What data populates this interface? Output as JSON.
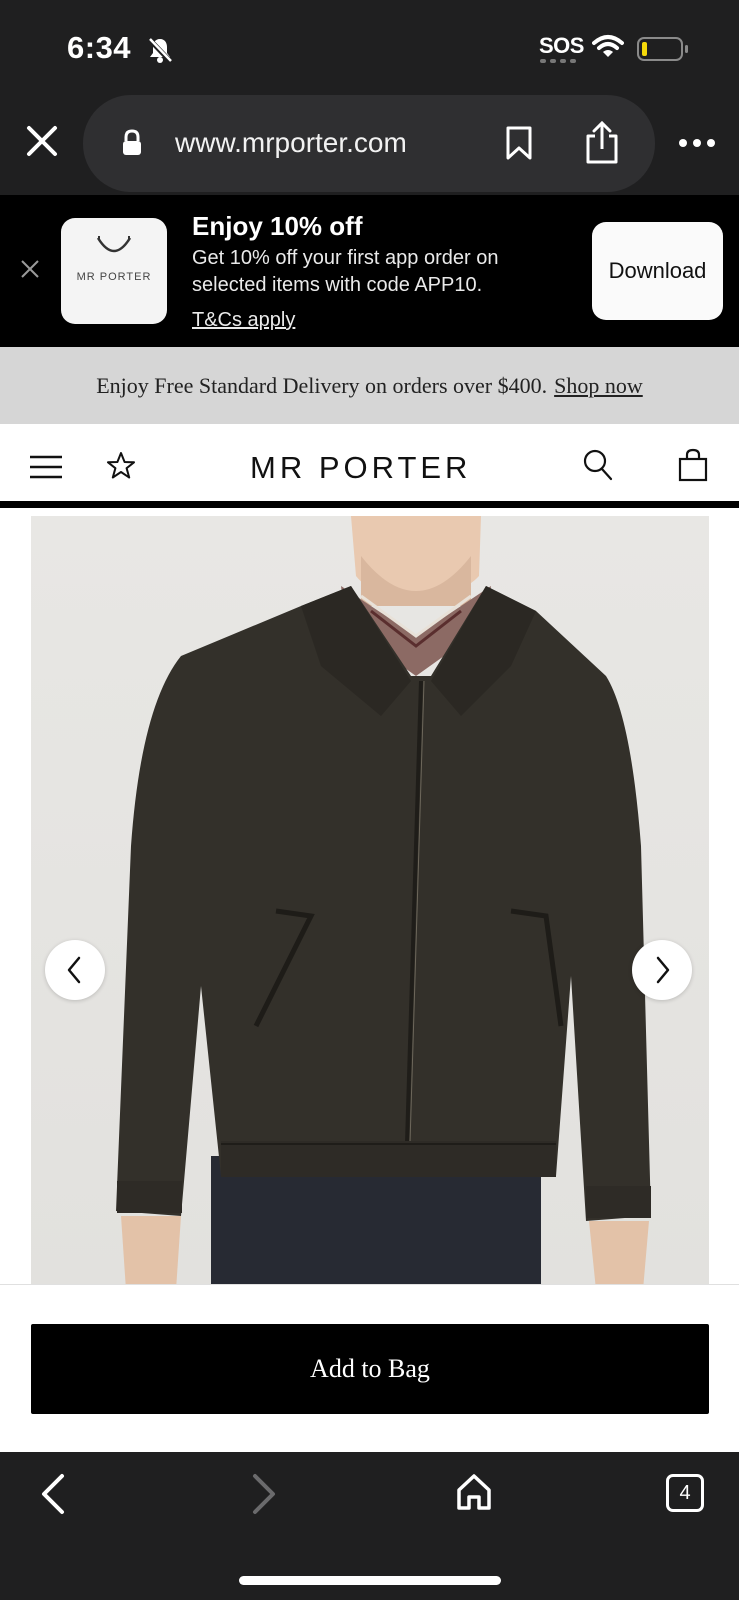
{
  "status_bar": {
    "time": "6:34",
    "sos_label": "SOS",
    "icons": [
      "bell-slash-icon",
      "wifi-icon",
      "battery-low-icon"
    ]
  },
  "browser": {
    "url": "www.mrporter.com",
    "icons": [
      "close-icon",
      "lock-icon",
      "bookmark-icon",
      "share-icon",
      "more-icon"
    ]
  },
  "app_banner": {
    "icon_text": "MR PORTER",
    "title": "Enjoy 10% off",
    "line1": "Get 10% off your first app order on",
    "line2": "selected items with code APP10.",
    "terms": "T&Cs apply",
    "download_label": "Download"
  },
  "delivery": {
    "text": "Enjoy Free Standard Delivery on orders over $400.",
    "link": "Shop now"
  },
  "header": {
    "logo": "MR PORTER",
    "icons": [
      "menu-icon",
      "star-icon",
      "search-icon",
      "bag-icon"
    ]
  },
  "product": {
    "image_alt": "Dark brown cotton canvas zip jacket worn over plaid shirt",
    "colors": {
      "jacket": "#33302a",
      "background": "#e6e5e2"
    }
  },
  "cta": {
    "add_to_bag": "Add to Bag"
  },
  "toolbar": {
    "tab_count": "4",
    "icons": [
      "back-icon",
      "forward-icon",
      "home-icon",
      "tabs-icon"
    ]
  }
}
